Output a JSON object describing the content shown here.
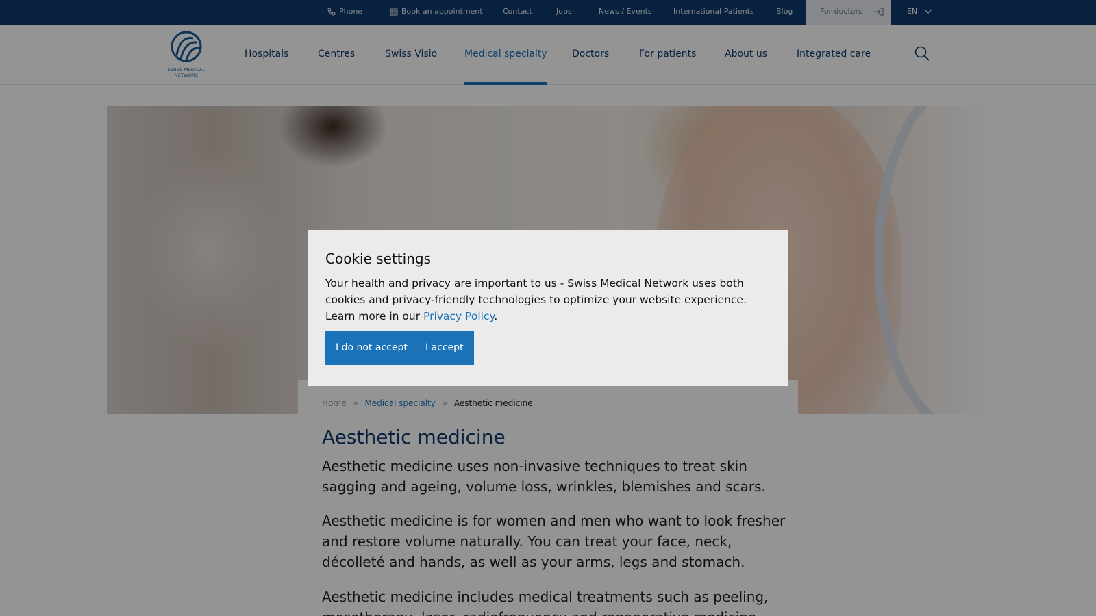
{
  "topbar": {
    "phone": "Phone",
    "appointment": "Book an appointment",
    "contact": "Contact",
    "jobs": "Jobs",
    "news": "News / Events",
    "international": "International Patients",
    "blog": "Blog",
    "for_doctors": "For doctors",
    "language": "EN"
  },
  "logo": {
    "line1": "SWISS MEDICAL",
    "line2": "NETWORK"
  },
  "nav": {
    "items": [
      "Hospitals",
      "Centres",
      "Swiss Visio",
      "Medical specialty",
      "Doctors",
      "For patients",
      "About us",
      "Integrated care"
    ],
    "active": "Medical specialty"
  },
  "breadcrumb": {
    "home": "Home",
    "sep": "»",
    "parent": "Medical specialty",
    "current": "Aesthetic medicine"
  },
  "page": {
    "title": "Aesthetic medicine",
    "paragraphs": [
      "Aesthetic medicine uses non-invasive techniques to treat skin sagging and ageing, volume loss, wrinkles, blemishes and scars.",
      "Aesthetic medicine is for women and men who want to look fresher and restore volume naturally. You can treat your face, neck, décolleté and hands, as well as your arms, legs and stomach.",
      "Aesthetic medicine includes medical treatments such as peeling, mesotherapy, laser, radiofrequency and regenerative medicine."
    ]
  },
  "cookie": {
    "title": "Cookie settings",
    "text": "Your health and privacy are important to us - Swiss Medical Network uses both cookies and privacy-friendly technologies to optimize your website experience. Learn more in our ",
    "link": "Privacy Policy",
    "text_end": ".",
    "decline": "I do not accept",
    "accept": "I accept"
  },
  "colors": {
    "topbar": "#0d3a6b",
    "accent": "#1a72b8",
    "heading": "#0d3a6b"
  }
}
